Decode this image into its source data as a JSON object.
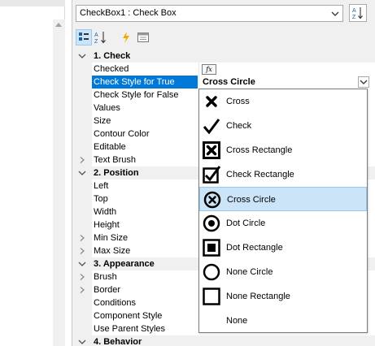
{
  "object_selector": {
    "value": "CheckBox1 : Check Box"
  },
  "categories": {
    "check": "1. Check",
    "position": "2. Position",
    "appearance": "3. Appearance",
    "behavior": "4. Behavior"
  },
  "properties": {
    "checked": "Checked",
    "check_style_true": "Check Style for True",
    "check_style_false": "Check Style for False",
    "values": "Values",
    "size": "Size",
    "contour_color": "Contour Color",
    "editable": "Editable",
    "text_brush": "Text Brush",
    "left": "Left",
    "top": "Top",
    "width": "Width",
    "height": "Height",
    "min_size": "Min Size",
    "max_size": "Max Size",
    "brush": "Brush",
    "border": "Border",
    "conditions": "Conditions",
    "component_style": "Component Style",
    "use_parent_styles": "Use Parent Styles"
  },
  "values": {
    "checked_fx": "fx",
    "check_style_true": "Cross Circle"
  },
  "dropdown": {
    "options": [
      {
        "label": "Cross",
        "icon": "cross-icon"
      },
      {
        "label": "Check",
        "icon": "check-icon"
      },
      {
        "label": "Cross Rectangle",
        "icon": "cross-rectangle-icon"
      },
      {
        "label": "Check Rectangle",
        "icon": "check-rectangle-icon"
      },
      {
        "label": "Cross Circle",
        "icon": "cross-circle-icon",
        "selected": true
      },
      {
        "label": "Dot Circle",
        "icon": "dot-circle-icon"
      },
      {
        "label": "Dot Rectangle",
        "icon": "dot-rectangle-icon"
      },
      {
        "label": "None Circle",
        "icon": "none-circle-icon"
      },
      {
        "label": "None Rectangle",
        "icon": "none-rectangle-icon"
      },
      {
        "label": "None",
        "icon": ""
      }
    ]
  },
  "colors": {
    "selection": "#0078d7",
    "highlight": "#cce4f7",
    "panel_bg": "#f0f0f0"
  }
}
